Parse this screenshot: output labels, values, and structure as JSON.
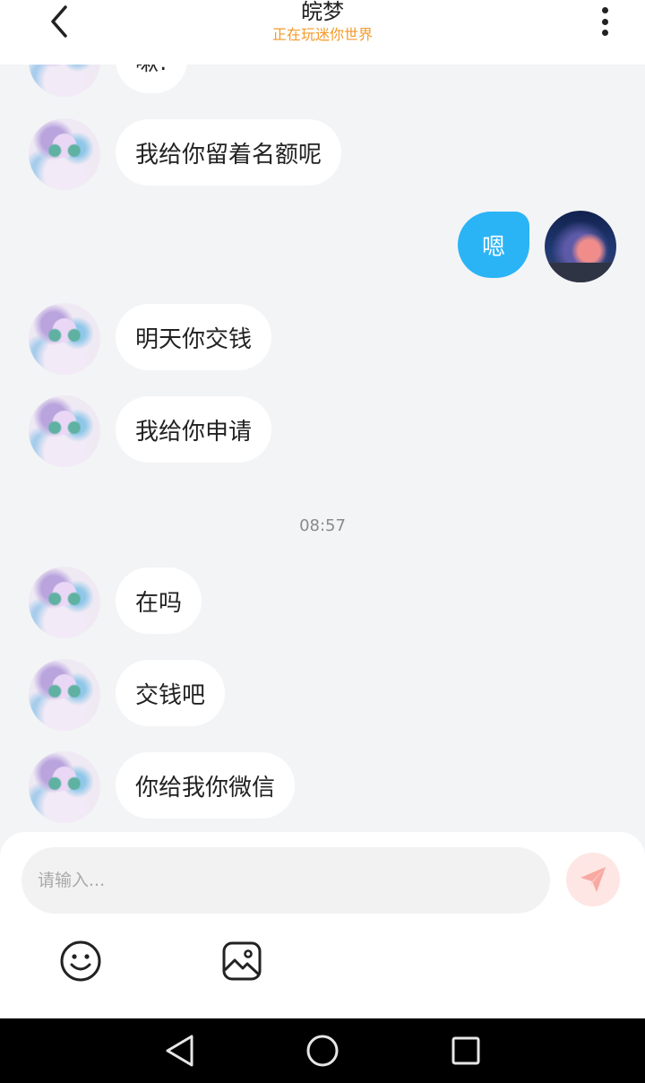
{
  "header": {
    "title": "皖梦",
    "subtitle": "正在玩迷你世界"
  },
  "messages": [
    {
      "from": "other",
      "text": "嗽!"
    },
    {
      "from": "other",
      "text": "我给你留着名额呢"
    },
    {
      "from": "me",
      "text": "嗯"
    },
    {
      "from": "other",
      "text": "明天你交钱"
    },
    {
      "from": "other",
      "text": "我给你申请"
    },
    {
      "from": "other",
      "text": "在吗"
    },
    {
      "from": "other",
      "text": "交钱吧"
    },
    {
      "from": "other",
      "text": "你给我你微信"
    }
  ],
  "timestamp": "08:57",
  "composer": {
    "placeholder": "请输入...",
    "value": ""
  },
  "icons": {
    "back": "chevron-left-icon",
    "more": "more-vertical-icon",
    "send": "paper-plane-icon",
    "emoji": "smiley-icon",
    "image": "image-icon",
    "nav_back": "triangle-back-icon",
    "nav_home": "circle-home-icon",
    "nav_recents": "square-recents-icon"
  },
  "colors": {
    "accent": "#2ab4f6",
    "subtitle": "#f39a2b",
    "background": "#f3f4f6",
    "send_button": "#fde6e3",
    "send_icon": "#f8a9a2"
  }
}
